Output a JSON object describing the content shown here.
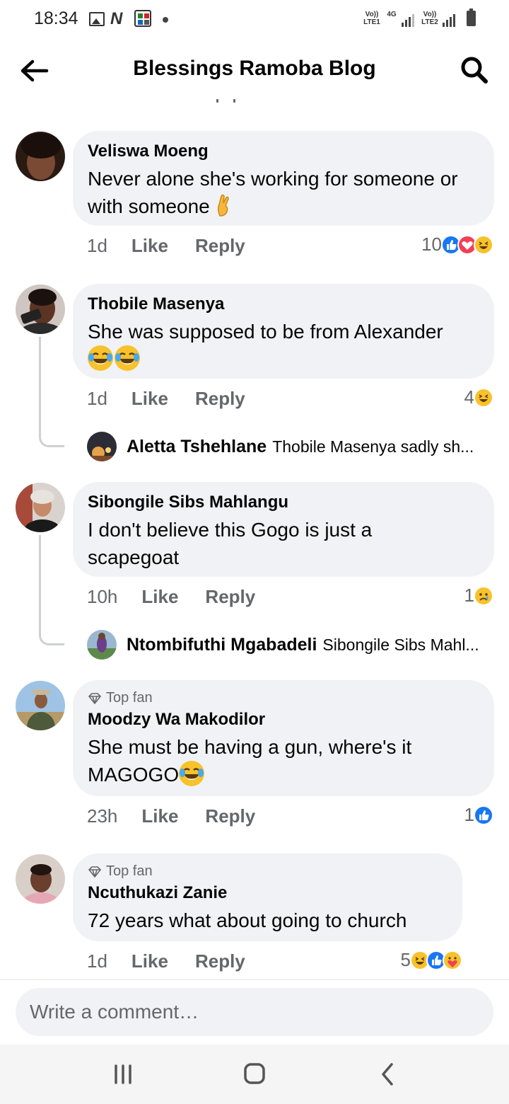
{
  "status_bar": {
    "time": "18:34",
    "sim1_label": "Vo)) LTE1",
    "network_label": "4G",
    "sim2_label": "Vo)) LTE2",
    "icons": [
      "gallery-icon",
      "netflix-n-icon",
      "app-grid-icon",
      "notification-dot-icon",
      "signal-icon",
      "battery-icon"
    ]
  },
  "header": {
    "title": "Blessings Ramoba Blog",
    "back_icon": "arrow-left-icon",
    "search_icon": "search-icon"
  },
  "comments": [
    {
      "author": "Veliswa Moeng",
      "text": "Never alone she's working for someone or with someone",
      "emoji": "crossed-fingers-emoji",
      "time": "1d",
      "like_label": "Like",
      "reply_label": "Reply",
      "reaction_count": "10",
      "reactions": [
        "like",
        "love",
        "haha"
      ]
    },
    {
      "author": "Thobile Masenya",
      "text": "She was supposed to be from Alexander",
      "emoji": "tears-of-joy-emoji x2",
      "time": "1d",
      "like_label": "Like",
      "reply_label": "Reply",
      "reaction_count": "4",
      "reactions": [
        "haha"
      ],
      "reply_preview": {
        "author": "Aletta Tshehlane",
        "text": "Thobile Masenya sadly sh..."
      }
    },
    {
      "author": "Sibongile Sibs Mahlangu",
      "text": "I don't believe this Gogo is just a scapegoat",
      "time": "10h",
      "like_label": "Like",
      "reply_label": "Reply",
      "reaction_count": "1",
      "reactions": [
        "sad"
      ],
      "reply_preview": {
        "author": "Ntombifuthi Mgabadeli",
        "text": "Sibongile Sibs Mahl..."
      }
    },
    {
      "badge": "Top fan",
      "author": "Moodzy Wa Makodilor",
      "text": "She must be having a gun, where's it MAGOGO",
      "emoji": "tears-of-joy-emoji",
      "time": "23h",
      "like_label": "Like",
      "reply_label": "Reply",
      "reaction_count": "1",
      "reactions": [
        "like"
      ]
    },
    {
      "badge": "Top fan",
      "author": "Ncuthukazi Zanie",
      "text": "72 years what about going to church",
      "time": "1d",
      "like_label": "Like",
      "reply_label": "Reply",
      "reaction_count": "5",
      "reactions": [
        "haha",
        "like",
        "care"
      ]
    }
  ],
  "composer": {
    "placeholder": "Write a comment…"
  },
  "nav_bar": {
    "icons": [
      "recent-apps-icon",
      "home-icon",
      "back-icon"
    ]
  },
  "colors": {
    "bubble": "#f0f2f5",
    "secondary_text": "#65676b",
    "like_blue": "#1877f2",
    "love_red": "#f33e58",
    "emoji_yellow": "#f7c22b"
  }
}
